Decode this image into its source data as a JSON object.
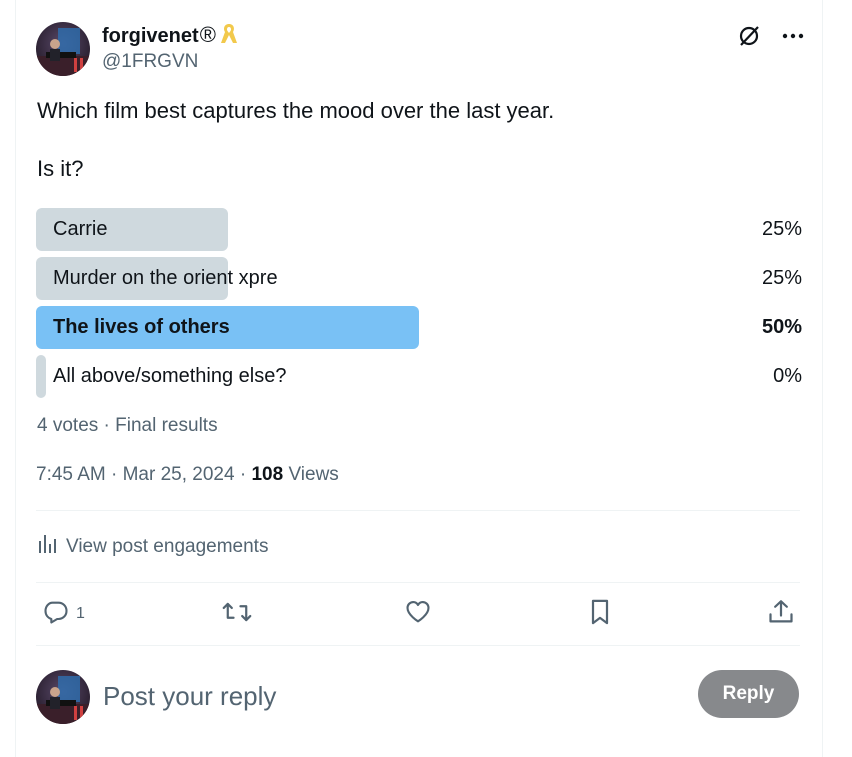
{
  "author": {
    "display_name": "forgivenet",
    "display_name_symbol": "®",
    "handle": "@1FRGVN",
    "ribbon_icon": "yellow-ribbon-icon",
    "ribbon_color": "#f2c94c"
  },
  "tweet": {
    "text": "Which film best captures the mood over the last year.\n\nIs it?"
  },
  "poll": {
    "options": [
      {
        "label": "Carrie",
        "percent_label": "25%",
        "percent": 25,
        "winner": false
      },
      {
        "label": "Murder on the orient xpre",
        "percent_label": "25%",
        "percent": 25,
        "winner": false
      },
      {
        "label": "The lives of others",
        "percent_label": "50%",
        "percent": 50,
        "winner": true
      },
      {
        "label": "All above/something else?",
        "percent_label": "0%",
        "percent": 0,
        "winner": false
      }
    ],
    "meta": "4 votes · Final results"
  },
  "timestamp": {
    "time": "7:45 AM",
    "separator": " · ",
    "date": "Mar 25, 2024",
    "views_count": "108",
    "views_label": "Views"
  },
  "engagements": {
    "label": "View post engagements"
  },
  "actions": {
    "reply_count": "1"
  },
  "reply_box": {
    "placeholder": "Post your reply",
    "button_label": "Reply"
  },
  "colors": {
    "text_primary": "#0f1419",
    "text_secondary": "#536471",
    "poll_bar": "#cfd9de",
    "poll_bar_winner": "#79c1f5",
    "reply_button": "#87898c",
    "divider": "#eff3f4"
  }
}
